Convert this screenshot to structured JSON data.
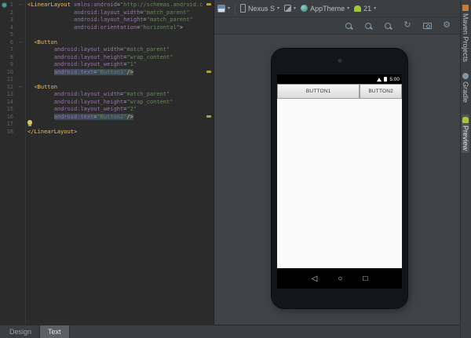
{
  "colors": {
    "editor_bg": "#2b2b2b",
    "panel_bg": "#3c3f41",
    "tag": "#e8bf6a",
    "attr_name": "#9876aa",
    "attr_value": "#6a8759",
    "plain_text": "#a9b7c6",
    "line_number": "#606366",
    "highlight_bg": "#3d4a57",
    "warning_mark": "#b3a33c",
    "android_green": "#a4c639"
  },
  "editor": {
    "warning_mark_lines": [
      1,
      10,
      16
    ],
    "lines": [
      {
        "n": 1,
        "fold": true,
        "seg": [
          [
            "tag",
            "<LinearLayout"
          ],
          [
            "plain",
            " "
          ],
          [
            "attr",
            "xmlns:android"
          ],
          [
            "plain",
            "="
          ],
          [
            "value",
            "\"http://schemas.android.c"
          ]
        ]
      },
      {
        "n": 2,
        "seg": [
          [
            "plain",
            "              "
          ],
          [
            "attr",
            "android:layout_width"
          ],
          [
            "plain",
            "="
          ],
          [
            "value",
            "\"match_parent\""
          ]
        ]
      },
      {
        "n": 3,
        "seg": [
          [
            "plain",
            "              "
          ],
          [
            "attr",
            "android:layout_height"
          ],
          [
            "plain",
            "="
          ],
          [
            "value",
            "\"match_parent\""
          ]
        ]
      },
      {
        "n": 4,
        "seg": [
          [
            "plain",
            "              "
          ],
          [
            "attr",
            "android:orientation"
          ],
          [
            "plain",
            "="
          ],
          [
            "value",
            "\"horizontal\""
          ],
          [
            "tag",
            ">"
          ]
        ]
      },
      {
        "n": 5,
        "seg": []
      },
      {
        "n": 6,
        "fold": true,
        "seg": [
          [
            "plain",
            "  "
          ],
          [
            "tag",
            "<Button"
          ]
        ]
      },
      {
        "n": 7,
        "seg": [
          [
            "plain",
            "        "
          ],
          [
            "attr",
            "android:layout_width"
          ],
          [
            "plain",
            "="
          ],
          [
            "value",
            "\"match_parent\""
          ]
        ]
      },
      {
        "n": 8,
        "seg": [
          [
            "plain",
            "        "
          ],
          [
            "attr",
            "android:layout_height"
          ],
          [
            "plain",
            "="
          ],
          [
            "value",
            "\"wrap_content\""
          ]
        ]
      },
      {
        "n": 9,
        "seg": [
          [
            "plain",
            "        "
          ],
          [
            "attr",
            "android:layout_weight"
          ],
          [
            "plain",
            "="
          ],
          [
            "value",
            "\"1\""
          ]
        ]
      },
      {
        "n": 10,
        "hl": true,
        "seg": [
          [
            "plain",
            "        "
          ],
          [
            "attr",
            "android:text"
          ],
          [
            "plain",
            "="
          ],
          [
            "value",
            "\"Button1\""
          ],
          [
            "tag",
            "/>"
          ]
        ]
      },
      {
        "n": 11,
        "seg": []
      },
      {
        "n": 12,
        "fold": true,
        "seg": [
          [
            "plain",
            "  "
          ],
          [
            "tag",
            "<Button"
          ]
        ]
      },
      {
        "n": 13,
        "seg": [
          [
            "plain",
            "        "
          ],
          [
            "attr",
            "android:layout_width"
          ],
          [
            "plain",
            "="
          ],
          [
            "value",
            "\"match_parent\""
          ]
        ]
      },
      {
        "n": 14,
        "seg": [
          [
            "plain",
            "        "
          ],
          [
            "attr",
            "android:layout_height"
          ],
          [
            "plain",
            "="
          ],
          [
            "value",
            "\"wrap_content\""
          ]
        ]
      },
      {
        "n": 15,
        "seg": [
          [
            "plain",
            "        "
          ],
          [
            "attr",
            "android:layout_weight"
          ],
          [
            "plain",
            "="
          ],
          [
            "value",
            "\"2\""
          ]
        ]
      },
      {
        "n": 16,
        "hl": true,
        "seg": [
          [
            "plain",
            "        "
          ],
          [
            "attr",
            "android:text"
          ],
          [
            "plain",
            "="
          ],
          [
            "value",
            "\"Button2\""
          ],
          [
            "tag",
            "/>"
          ]
        ]
      },
      {
        "n": 17,
        "bulb": true,
        "seg": []
      },
      {
        "n": 18,
        "seg": [
          [
            "tag",
            "</LinearLayout>"
          ]
        ]
      }
    ]
  },
  "preview_toolbar": {
    "device_label": "Nexus S",
    "theme_label": "AppTheme",
    "api_label": "21",
    "row2_icons": [
      "zoom-fit-icon",
      "zoom-actual-icon",
      "zoom-in-icon",
      "refresh-icon",
      "screenshot-camera-icon",
      "settings-gear-icon"
    ]
  },
  "right_tool_tabs": [
    {
      "label": "Maven Projects",
      "icon": "maven-icon",
      "active": false
    },
    {
      "label": "Gradle",
      "icon": "gradle-icon",
      "active": false
    },
    {
      "label": "Preview",
      "icon": "android-icon",
      "active": true
    }
  ],
  "device_preview": {
    "status_time": "5:00",
    "buttons": [
      {
        "label": "BUTTON1",
        "flex": 2
      },
      {
        "label": "BUTTON2",
        "flex": 1
      }
    ],
    "nav": {
      "back": "◁",
      "home": "○",
      "recents": "□"
    }
  },
  "bottom_tabs": [
    {
      "label": "Design",
      "active": false
    },
    {
      "label": "Text",
      "active": true
    }
  ]
}
